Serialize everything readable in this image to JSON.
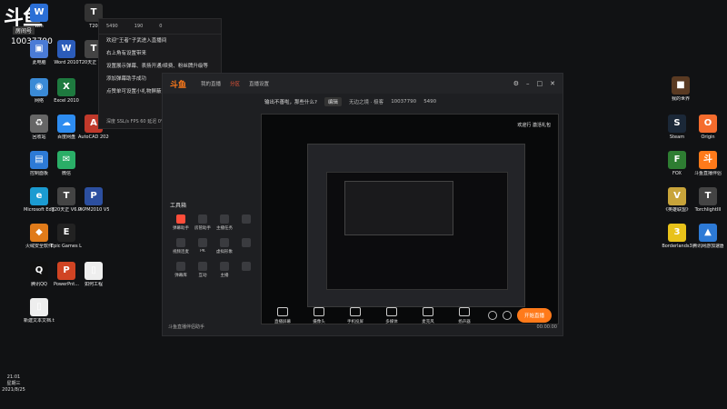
{
  "stream": {
    "logo": "斗鱼",
    "room_label": "房间号",
    "room_id": "10037790"
  },
  "left_icons": [
    {
      "label": "Win",
      "name": "win-icon",
      "glyph": "W",
      "color": "#2b6fd6"
    },
    {
      "label": "T20",
      "name": "t20-icon",
      "glyph": "T",
      "color": "#333"
    },
    {
      "label": "此电脑",
      "name": "computer-icon",
      "glyph": "▣",
      "color": "#4a7bd6"
    },
    {
      "label": "Word 2010",
      "name": "word-icon",
      "glyph": "W",
      "color": "#2b5cba"
    },
    {
      "label": "T20天正 V7.0",
      "name": "t20-v7-icon",
      "glyph": "T",
      "color": "#444"
    },
    {
      "label": "网络",
      "name": "network-icon",
      "glyph": "◉",
      "color": "#3a8ad6"
    },
    {
      "label": "Excel 2010",
      "name": "excel-icon",
      "glyph": "X",
      "color": "#1e7a3f"
    },
    {
      "label": "回收站",
      "name": "recycle-icon",
      "glyph": "♻",
      "color": "#666"
    },
    {
      "label": "百度网盘",
      "name": "baidu-pan-icon",
      "glyph": "☁",
      "color": "#2d8cf0"
    },
    {
      "label": "AutoCAD 2020",
      "name": "autocad-icon",
      "glyph": "A",
      "color": "#c0392b"
    },
    {
      "label": "控制面板",
      "name": "control-panel-icon",
      "glyph": "▤",
      "color": "#2d7ad6"
    },
    {
      "label": "微信",
      "name": "wechat-icon",
      "glyph": "✉",
      "color": "#2aae67"
    },
    {
      "label": "Microsoft Edge",
      "name": "edge-icon",
      "glyph": "e",
      "color": "#1b9bd1"
    },
    {
      "label": "T20天正 V6.0",
      "name": "t20-v6-icon",
      "glyph": "T",
      "color": "#444"
    },
    {
      "label": "PKPM2010 V52",
      "name": "pkpm-icon",
      "glyph": "P",
      "color": "#2c4fa0"
    },
    {
      "label": "火绒安全软件",
      "name": "huorong-icon",
      "glyph": "◆",
      "color": "#e07b1a"
    },
    {
      "label": "Epic Games Launcher",
      "name": "epic-icon",
      "glyph": "E",
      "color": "#222"
    },
    {
      "label": "腾讯QQ",
      "name": "qq-icon",
      "glyph": "Q",
      "color": "#111"
    },
    {
      "label": "PowerPnt...",
      "name": "powerpoint-icon",
      "glyph": "P",
      "color": "#d04423"
    },
    {
      "label": "如何工程",
      "name": "pdf-icon",
      "glyph": "▯",
      "color": "#eee"
    },
    {
      "label": "新建文本文档.txt",
      "name": "text-file-icon",
      "glyph": "▯",
      "color": "#eee"
    }
  ],
  "right_icons": [
    {
      "label": "我的世界",
      "name": "minecraft-icon",
      "glyph": "■",
      "color": "#5a3a22"
    },
    {
      "label": "Steam",
      "name": "steam-icon",
      "glyph": "S",
      "color": "#1b2838"
    },
    {
      "label": "Origin",
      "name": "origin-icon",
      "glyph": "O",
      "color": "#f56c2d"
    },
    {
      "label": "FOX",
      "name": "fox-icon",
      "glyph": "F",
      "color": "#2e7d32"
    },
    {
      "label": "斗鱼直播伴侣",
      "name": "douyu-companion-icon",
      "glyph": "斗",
      "color": "#ff7a1a"
    },
    {
      "label": "《英雄联盟》",
      "name": "lol-icon",
      "glyph": "V",
      "color": "#c8a43a"
    },
    {
      "label": "TorchlightIII",
      "name": "torchlight-icon",
      "glyph": "T",
      "color": "#444"
    },
    {
      "label": "Borderlands3",
      "name": "borderlands-icon",
      "glyph": "3",
      "color": "#e8c21a"
    },
    {
      "label": "腾讯网游加速器",
      "name": "tencent-accel-icon",
      "glyph": "▲",
      "color": "#2d7ad6"
    }
  ],
  "chat": {
    "stats": [
      "5490",
      "190",
      "0"
    ],
    "messages": [
      "欢迎“王者”子武进入直播间",
      "右上角有设置带来",
      "设置展示弹幕、表扬开通/续费、粉丝牌升级等",
      "添加弹幕助手成功",
      "点赞单可设置小礼物屏蔽"
    ],
    "footer": "深度 SSL/s  FPS 60  延迟 0%  CPU 26  内存 16%"
  },
  "app": {
    "logo": "斗鱼",
    "tabs": [
      "我的直播",
      "分区",
      "直播设置"
    ],
    "active_tab": "分区",
    "stream_title": "输出不善啦，那些什么?",
    "edit_label": "编辑",
    "category": "无边之境 · 极客",
    "room": "10037790",
    "watchers": "5490",
    "preview_label": "欢迎行 激活礼包",
    "tools_title": "工具箱",
    "tools": [
      {
        "label": "弹幕助手",
        "name": "danmu-tool",
        "red": true
      },
      {
        "label": "房管助手",
        "name": "manager-tool",
        "red": false
      },
      {
        "label": "主播任务",
        "name": "task-tool",
        "red": false
      },
      {
        "label": "",
        "name": "more-tool",
        "red": false
      },
      {
        "label": "视频连麦",
        "name": "video-link-tool",
        "red": false
      },
      {
        "label": "PK",
        "name": "pk-tool",
        "red": false
      },
      {
        "label": "虚拟形象",
        "name": "avatar-tool",
        "red": false
      },
      {
        "label": "",
        "name": "more2-tool",
        "red": false
      },
      {
        "label": "弹幕库",
        "name": "library-tool",
        "red": false
      },
      {
        "label": "互动",
        "name": "interact-tool",
        "red": false
      },
      {
        "label": "主播",
        "name": "anchor-tool",
        "red": false
      },
      {
        "label": "",
        "name": "more3-tool",
        "red": false
      }
    ],
    "bottom_buttons": [
      {
        "label": "直播屏幕",
        "name": "screen-source-button"
      },
      {
        "label": "摄像头",
        "name": "camera-button"
      },
      {
        "label": "手机投屏",
        "name": "phone-cast-button"
      },
      {
        "label": "多媒体",
        "name": "media-button"
      },
      {
        "label": "麦克风",
        "name": "mic-button"
      },
      {
        "label": "扬声器",
        "name": "speaker-button"
      }
    ],
    "start_button": "开始直播",
    "status": "斗鱼直播伴侣助手",
    "timer": "00:00:00"
  },
  "clock": {
    "time": "21:01",
    "day": "星期三",
    "date": "2021/8/25"
  }
}
